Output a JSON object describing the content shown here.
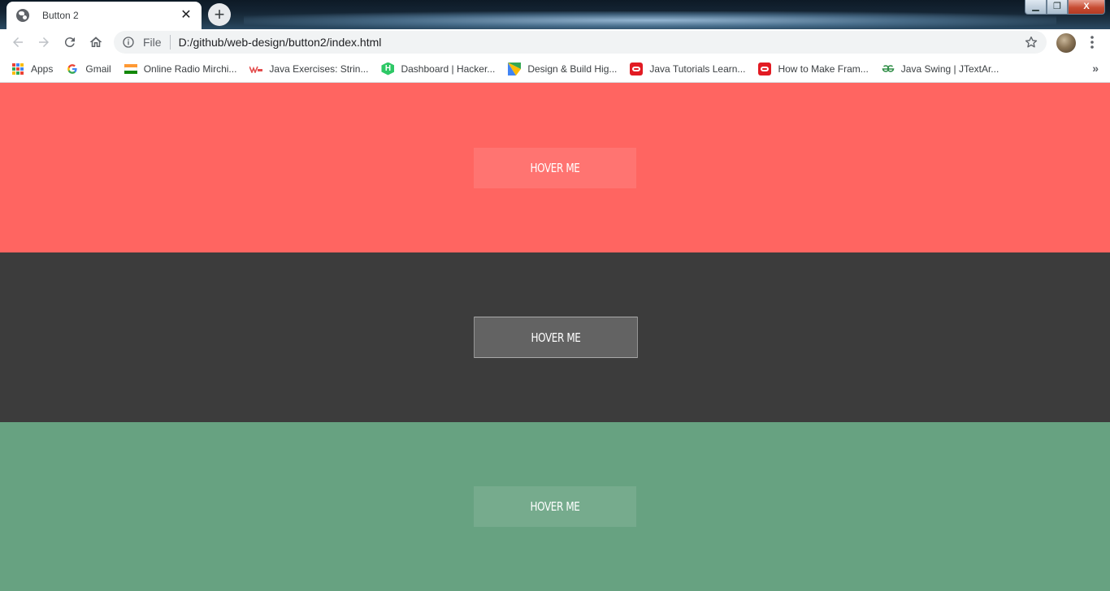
{
  "browser": {
    "tab_title": "Button 2",
    "tab_close_glyph": "✕",
    "new_tab_glyph": "+",
    "window_buttons": {
      "minimize": "▁",
      "maximize": "❐",
      "close": "X"
    }
  },
  "toolbar": {
    "scheme_label": "File",
    "url": "D:/github/web-design/button2/index.html"
  },
  "bookmarks": {
    "items": [
      {
        "label": "Apps",
        "icon": "apps-grid-icon"
      },
      {
        "label": "Gmail",
        "icon": "google-icon"
      },
      {
        "label": "Online Radio Mirchi...",
        "icon": "india-flag-icon"
      },
      {
        "label": "Java Exercises: Strin...",
        "icon": "w3resource-icon"
      },
      {
        "label": "Dashboard | Hacker...",
        "icon": "hackerrank-icon"
      },
      {
        "label": "Design & Build Hig...",
        "icon": "android-design-icon"
      },
      {
        "label": "Java Tutorials Learn...",
        "icon": "oracle-icon"
      },
      {
        "label": "How to Make Fram...",
        "icon": "oracle-icon"
      },
      {
        "label": "Java Swing | JTextAr...",
        "icon": "geeksforgeeks-icon"
      }
    ],
    "more_glyph": "»"
  },
  "sections": [
    {
      "button_label": "HOVER ME",
      "bg_color": "#ff6561"
    },
    {
      "button_label": "HOVER ME",
      "bg_color": "#3c3c3c"
    },
    {
      "button_label": "HOVER ME",
      "bg_color": "#67a281"
    }
  ],
  "colors": {
    "tab_bg": "#ffffff",
    "omnibox_bg": "#f1f3f4",
    "button_text": "#ffffff"
  }
}
